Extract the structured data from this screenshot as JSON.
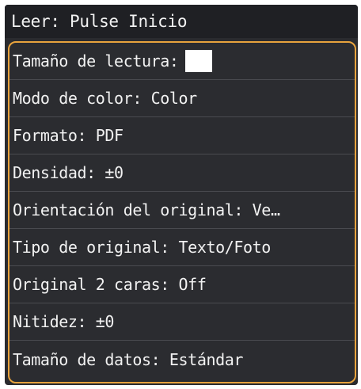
{
  "title": "Leer: Pulse Inicio",
  "menu": {
    "items": [
      {
        "label": "Tamaño de lectura:"
      },
      {
        "label": "Modo de color: Color"
      },
      {
        "label": "Formato: PDF"
      },
      {
        "label": "Densidad: ±0"
      },
      {
        "label": "Orientación del original: Ve…"
      },
      {
        "label": "Tipo de original: Texto/Foto"
      },
      {
        "label": "Original 2 caras: Off"
      },
      {
        "label": "Nitidez: ±0"
      },
      {
        "label": "Tamaño de datos: Estándar"
      }
    ]
  },
  "colors": {
    "background": "#2a2b2f",
    "title_bar": "#1f2024",
    "accent_border": "#e8a33d",
    "text": "#f2f2f2",
    "divider": "#4a4b50"
  }
}
